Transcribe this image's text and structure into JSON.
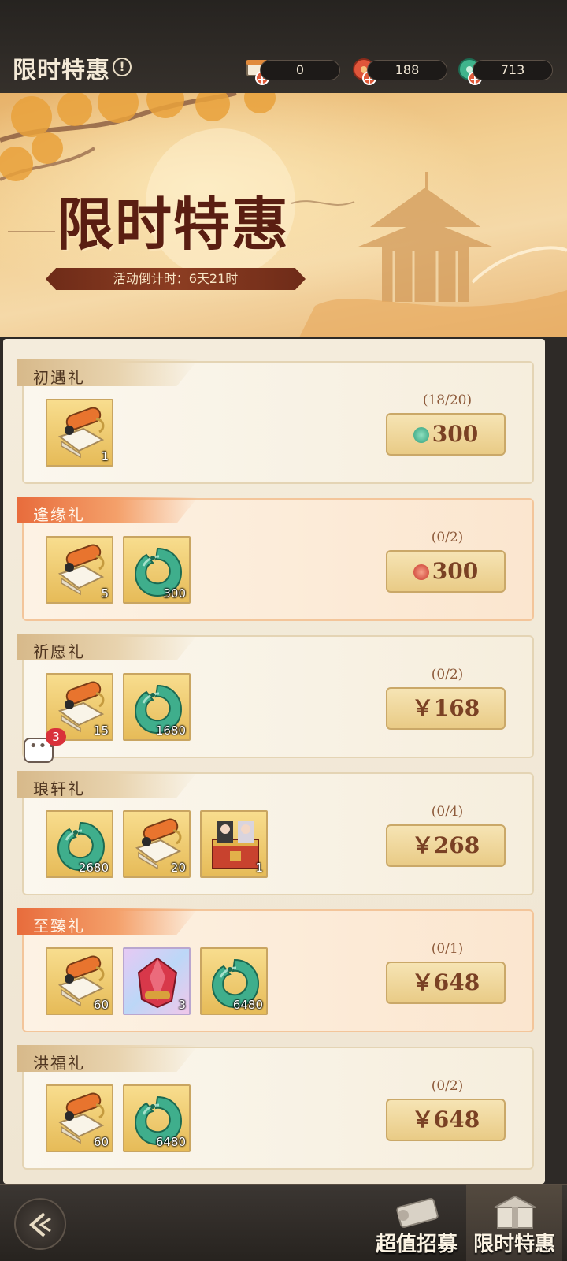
{
  "header": {
    "title": "限时特惠",
    "info_icon": "info-icon",
    "currencies": [
      {
        "name": "scroll-ticket",
        "value": "0"
      },
      {
        "name": "red-jade",
        "value": "188"
      },
      {
        "name": "green-jade",
        "value": "713"
      }
    ]
  },
  "banner": {
    "title": "限时特惠",
    "countdown": "活动倒计时：6天21时"
  },
  "packs": [
    {
      "name": "初遇礼",
      "limit": "(18/20)",
      "price": "300",
      "currency_icon": "green-jade-icon",
      "items": [
        {
          "icon": "scroll-icon",
          "qty": "1"
        }
      ]
    },
    {
      "name": "逢缘礼",
      "limit": "(0/2)",
      "price": "300",
      "currency_icon": "red-jade-icon",
      "items": [
        {
          "icon": "scroll-icon",
          "qty": "5"
        },
        {
          "icon": "jade-icon",
          "qty": "300"
        }
      ]
    },
    {
      "name": "祈愿礼",
      "limit": "(0/2)",
      "price": "￥168",
      "items": [
        {
          "icon": "scroll-icon",
          "qty": "15"
        },
        {
          "icon": "jade-icon",
          "qty": "1680"
        }
      ]
    },
    {
      "name": "琅轩礼",
      "limit": "(0/4)",
      "price": "￥268",
      "items": [
        {
          "icon": "jade-icon",
          "qty": "2680"
        },
        {
          "icon": "scroll-icon",
          "qty": "20"
        },
        {
          "icon": "portrait-chest-icon",
          "qty": "1"
        }
      ]
    },
    {
      "name": "至臻礼",
      "limit": "(0/1)",
      "price": "￥648",
      "items": [
        {
          "icon": "scroll-icon",
          "qty": "60"
        },
        {
          "icon": "red-crystal-icon",
          "qty": "3"
        },
        {
          "icon": "jade-icon",
          "qty": "6480"
        }
      ]
    },
    {
      "name": "洪福礼",
      "limit": "(0/2)",
      "price": "￥648",
      "items": [
        {
          "icon": "scroll-icon",
          "qty": "60"
        },
        {
          "icon": "jade-icon",
          "qty": "6480"
        }
      ]
    }
  ],
  "chat": {
    "badge": "3"
  },
  "nav": {
    "tabs": [
      {
        "label": "超值招募"
      },
      {
        "label": "限时特惠"
      }
    ]
  },
  "colors": {
    "accent_red": "#e86c3c",
    "price_text": "#7a4124",
    "gold_tile": "#e6bb58"
  }
}
